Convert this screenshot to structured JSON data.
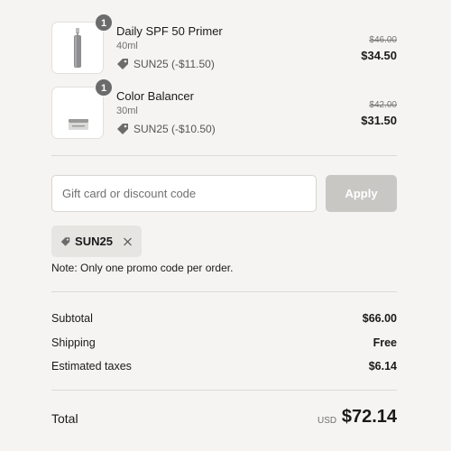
{
  "items": [
    {
      "quantity": "1",
      "name": "Daily SPF 50 Primer",
      "variant": "40ml",
      "discount": "SUN25 (-$11.50)",
      "original_price": "$46.00",
      "price": "$34.50",
      "thumb_icon": "bottle-product-icon"
    },
    {
      "quantity": "1",
      "name": "Color Balancer",
      "variant": "30ml",
      "discount": "SUN25 (-$10.50)",
      "original_price": "$42.00",
      "price": "$31.50",
      "thumb_icon": "jar-product-icon"
    }
  ],
  "discount_form": {
    "placeholder": "Gift card or discount code",
    "value": "",
    "apply_label": "Apply"
  },
  "applied_code": {
    "code": "SUN25"
  },
  "note": "Note: Only one promo code per order.",
  "summary": {
    "subtotal_label": "Subtotal",
    "subtotal_value": "$66.00",
    "shipping_label": "Shipping",
    "shipping_value": "Free",
    "taxes_label": "Estimated taxes",
    "taxes_value": "$6.14"
  },
  "total": {
    "label": "Total",
    "currency": "USD",
    "value": "$72.14"
  },
  "colors": {
    "background": "#f5f4f2",
    "apply_disabled": "#c8c7c4",
    "badge": "#6b6b6b",
    "chip": "#e6e5e2"
  }
}
